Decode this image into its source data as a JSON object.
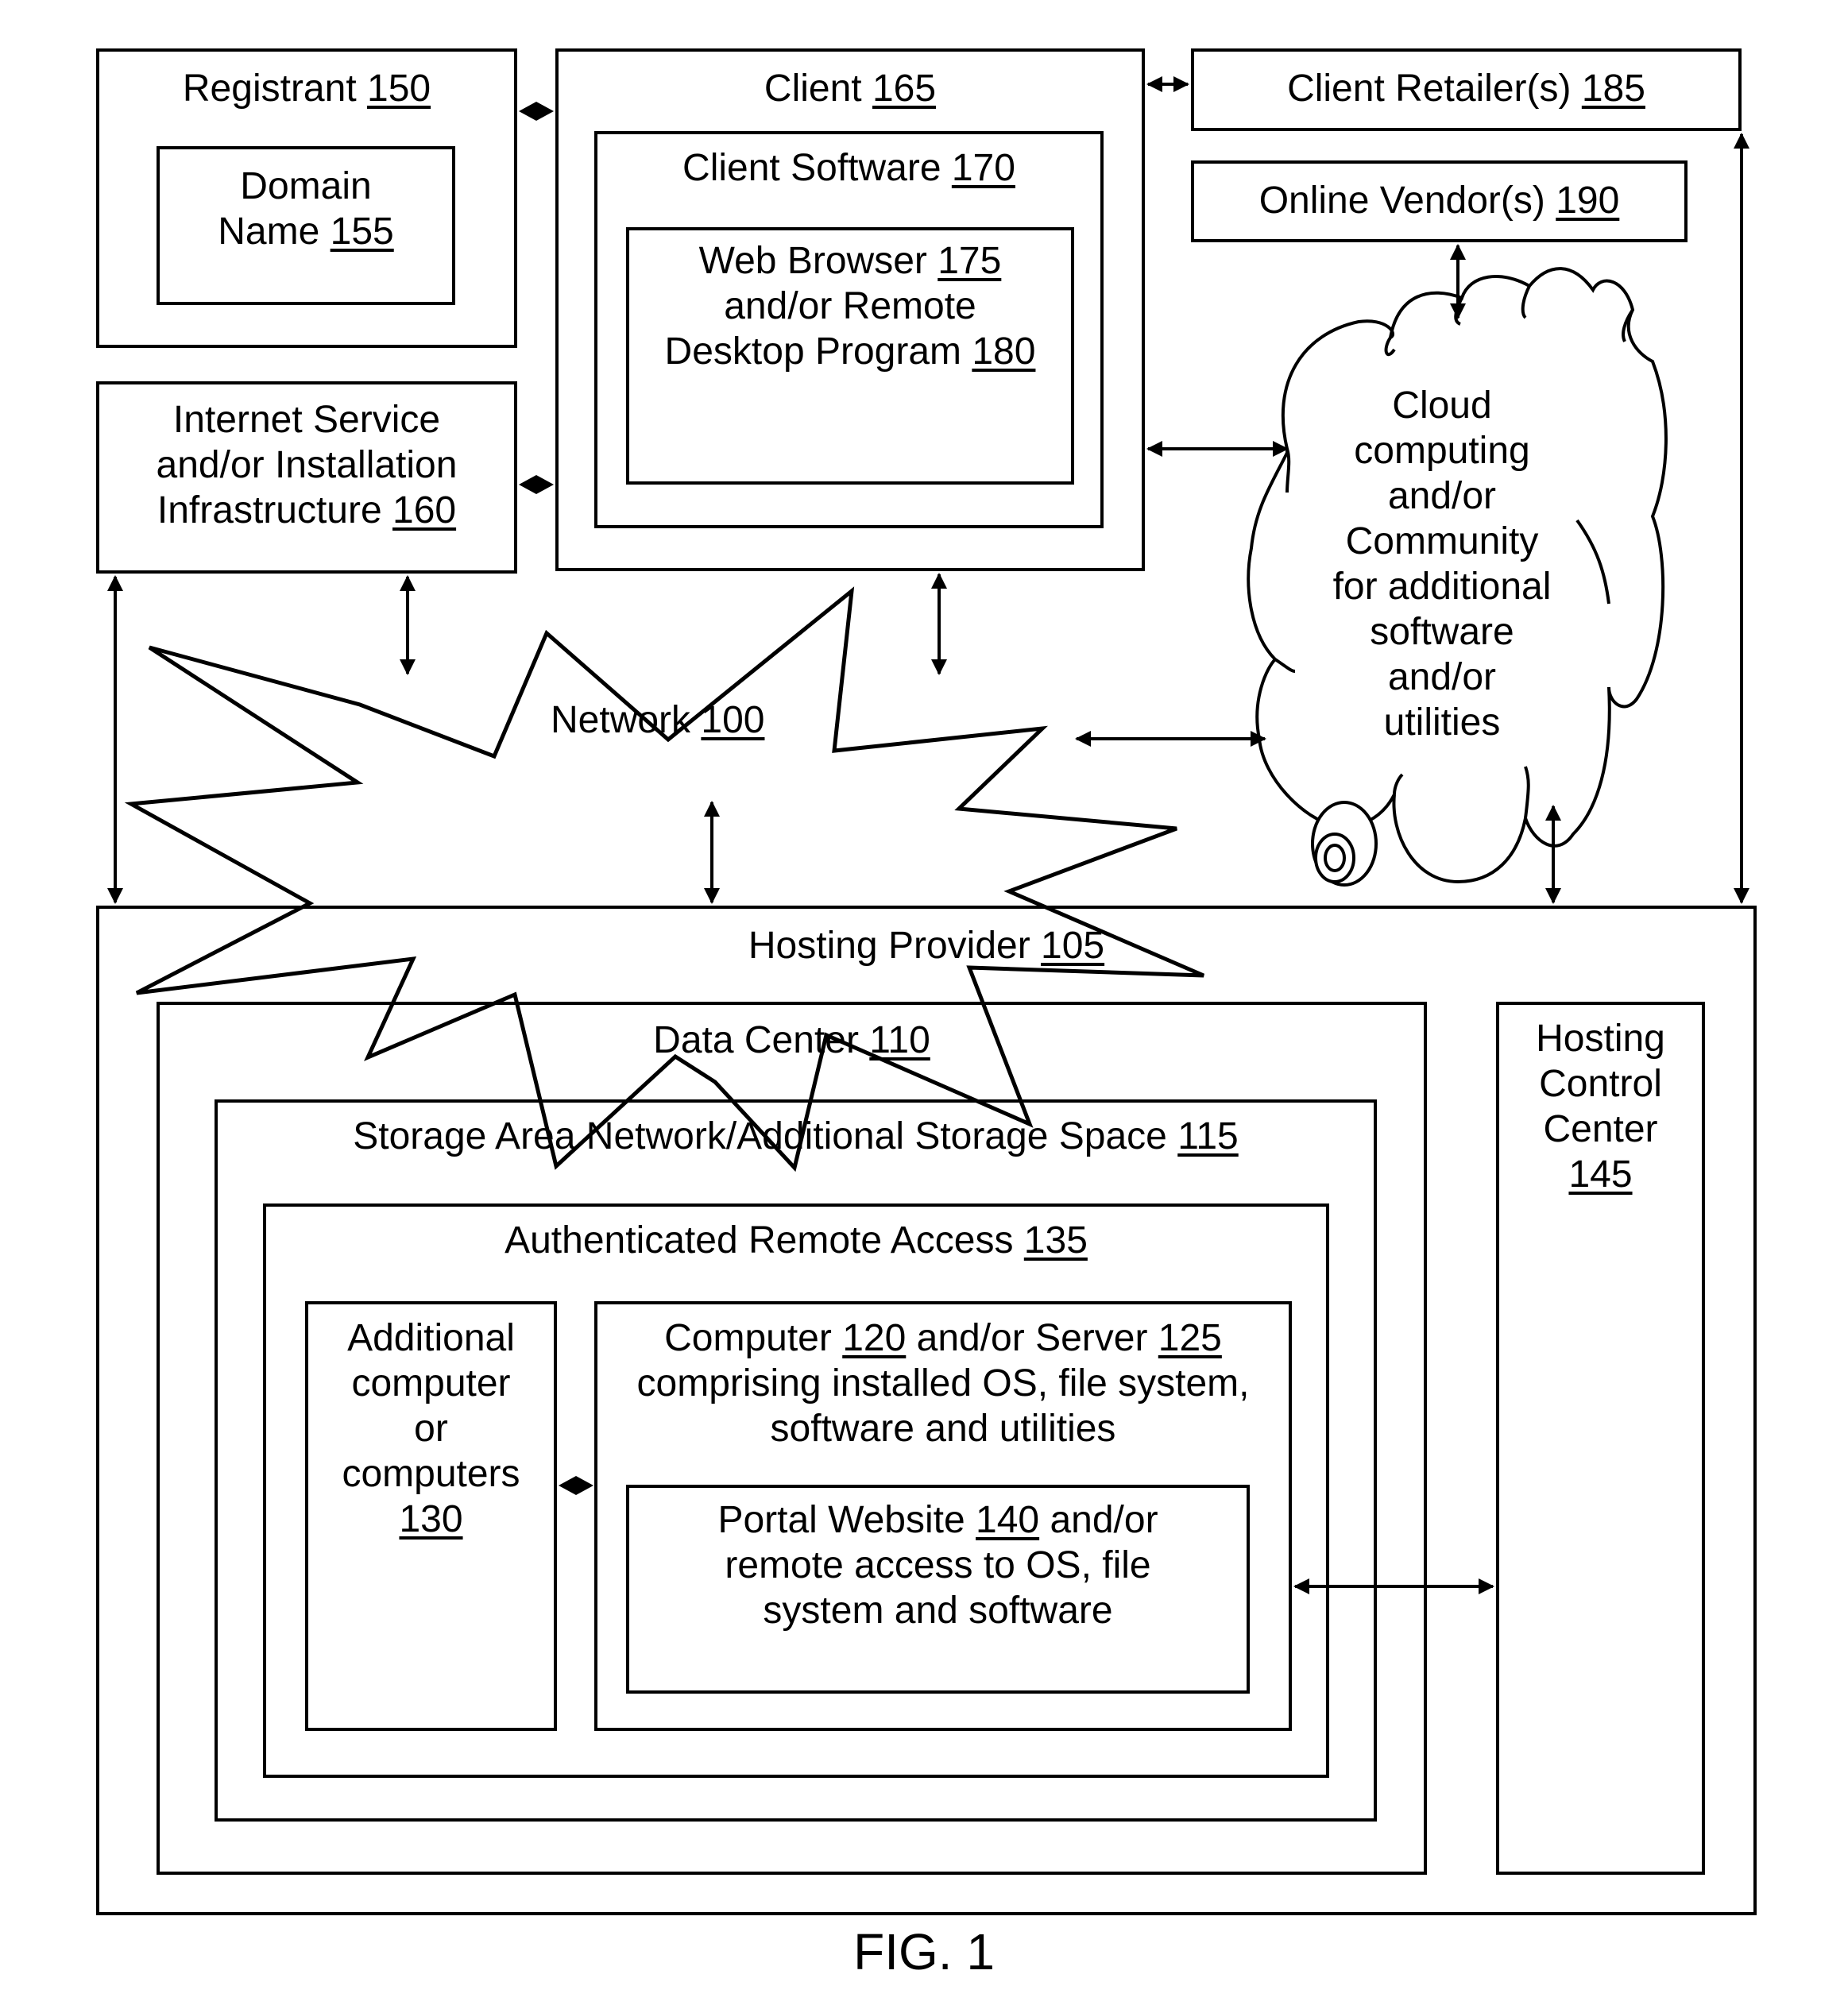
{
  "figure_label": "FIG. 1",
  "nodes": {
    "registrant": {
      "text": "Registrant ",
      "ref": "150"
    },
    "domain_name": {
      "line1": "Domain",
      "text": "Name ",
      "ref": "155"
    },
    "client": {
      "text": "Client ",
      "ref": "165"
    },
    "client_software": {
      "text": "Client Software ",
      "ref": "170"
    },
    "web_browser": {
      "line1_text": "Web Browser ",
      "line1_ref": "175",
      "line2": "and/or Remote",
      "line3_text": "Desktop Program ",
      "line3_ref": "180"
    },
    "client_retailers": {
      "text": "Client Retailer(s) ",
      "ref": "185"
    },
    "online_vendors": {
      "text": "Online Vendor(s) ",
      "ref": "190"
    },
    "internet_service": {
      "line1": "Internet Service",
      "line2": "and/or Installation",
      "line3_text": "Infrastructure ",
      "line3_ref": "160"
    },
    "network": {
      "text": "Network ",
      "ref": "100"
    },
    "cloud": {
      "lines": [
        "Cloud",
        "computing",
        "and/or",
        "Community",
        "for additional",
        "software",
        "and/or",
        "utilities"
      ]
    },
    "hosting_provider": {
      "text": "Hosting Provider ",
      "ref": "105"
    },
    "data_center": {
      "text": "Data Center ",
      "ref": "110"
    },
    "storage_area_network": {
      "text": "Storage Area Network/Additional Storage Space ",
      "ref": "115"
    },
    "authenticated_remote_access": {
      "text": "Authenticated Remote Access ",
      "ref": "135"
    },
    "additional_computers": {
      "line1": "Additional",
      "line2": "computer",
      "line3": "or",
      "line4": "computers",
      "ref": "130"
    },
    "computer_server": {
      "l1a": "Computer ",
      "l1ref1": "120",
      "l1b": " and/or Server ",
      "l1ref2": "125",
      "line2": "comprising installed OS, file system,",
      "line3": "software and utilities"
    },
    "portal_website": {
      "l1a": "Portal Website ",
      "l1ref": "140",
      "l1b": " and/or",
      "line2": "remote access to OS, file",
      "line3": "system and software"
    },
    "hosting_control_center": {
      "line1": "Hosting",
      "line2": "Control",
      "line3": "Center",
      "ref": "145"
    }
  },
  "connections": [
    {
      "from": "registrant",
      "to": "client",
      "style": "diamond"
    },
    {
      "from": "internet_service",
      "to": "client",
      "style": "diamond"
    },
    {
      "from": "client",
      "to": "client_retailers",
      "style": "double-arrow"
    },
    {
      "from": "online_vendors",
      "to": "cloud",
      "style": "double-arrow"
    },
    {
      "from": "client",
      "to": "cloud",
      "style": "double-arrow"
    },
    {
      "from": "internet_service",
      "to": "network",
      "style": "double-arrow"
    },
    {
      "from": "client",
      "to": "network",
      "style": "double-arrow"
    },
    {
      "from": "network",
      "to": "cloud",
      "style": "double-arrow"
    },
    {
      "from": "network",
      "to": "hosting_provider",
      "style": "double-arrow"
    },
    {
      "from": "internet_service",
      "to": "hosting_provider",
      "style": "double-arrow"
    },
    {
      "from": "cloud",
      "to": "hosting_provider",
      "style": "double-arrow"
    },
    {
      "from": "client_retailers",
      "to": "hosting_provider",
      "style": "double-arrow"
    },
    {
      "from": "additional_computers",
      "to": "computer_server",
      "style": "diamond"
    },
    {
      "from": "computer_server",
      "to": "hosting_control_center",
      "style": "double-arrow"
    }
  ]
}
